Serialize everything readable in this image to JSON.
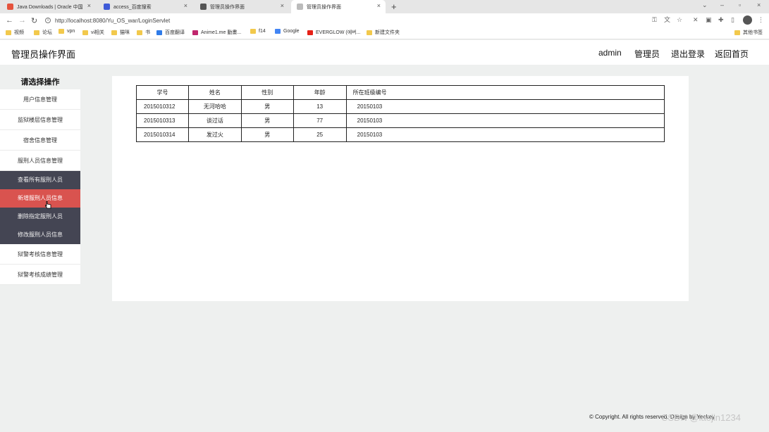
{
  "browser": {
    "tabs": [
      {
        "title": "Java Downloads | Oracle 中国",
        "active": false,
        "color": "#e5533d"
      },
      {
        "title": "access_百度搜索",
        "active": false,
        "color": "#3f5bd8"
      },
      {
        "title": "管理员操作界面",
        "active": false,
        "color": "#555555"
      },
      {
        "title": "管理员操作界面",
        "active": true,
        "color": "#888888"
      }
    ],
    "new_tab": "+",
    "url": "http://localhost:8080/Yu_OS_war/LoginServlet",
    "bookmarks": [
      "视频",
      "论坛",
      "vpn",
      "vi相关",
      "猫咪",
      "书",
      "百度翻译",
      "Anime1.me 動畫...",
      "f14",
      "Google",
      "EVERGLOW (에버...",
      "新建文件夹"
    ],
    "other_bookmarks": "其他书签"
  },
  "header": {
    "title": "管理员操作界面",
    "nav": [
      "admin",
      "管理员",
      "退出登录",
      "返回首页"
    ]
  },
  "sidebar": {
    "title": "请选择操作",
    "items_top": [
      "用户信息管理",
      "监狱楼层信息管理",
      "宿舍信息管理",
      "服刑人员信息管理"
    ],
    "sub_items": [
      "查看所有服刑人员",
      "新增服刑人员信息",
      "删除指定服刑人员",
      "修改服刑人员信息"
    ],
    "active_sub": 1,
    "items_bottom": [
      "狱警考核信息管理",
      "狱警考核成绩管理"
    ]
  },
  "table": {
    "headers": [
      "学号",
      "姓名",
      "性别",
      "年龄",
      "所在班级编号"
    ],
    "rows": [
      [
        "2015010312",
        "无河哈哈",
        "男",
        "13",
        "20150103"
      ],
      [
        "2015010313",
        "谈过话",
        "男",
        "77",
        "20150103"
      ],
      [
        "2015010314",
        "发过火",
        "男",
        "25",
        "20150103"
      ]
    ]
  },
  "footer": {
    "copyright": "© Copyright. All rights reserved. Design by Yeckey"
  },
  "watermark": "CSDN @laojin1234"
}
